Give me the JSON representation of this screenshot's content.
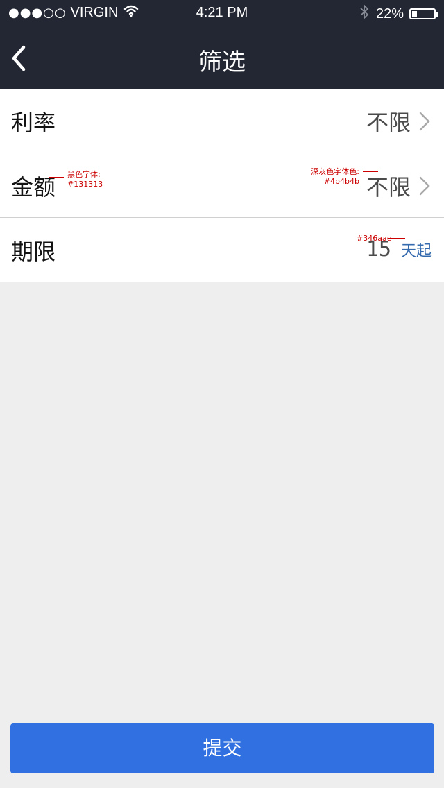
{
  "status_bar": {
    "signal": "●●●○○",
    "carrier": "VIRGIN",
    "time": "4:21 PM",
    "battery": "22%",
    "battery_level": 0.22
  },
  "nav": {
    "title": "筛选",
    "back_icon": "chevron-left-icon"
  },
  "filters": [
    {
      "label": "利率",
      "value": "不限"
    },
    {
      "label": "金额",
      "value": "不限"
    },
    {
      "label": "期限",
      "number": "15",
      "unit": "天起"
    }
  ],
  "annotations": {
    "black": {
      "title": "黑色字体:",
      "color": "#131313"
    },
    "gray": {
      "title": "深灰色字体色:",
      "color": "#4b4b4b"
    },
    "blue": {
      "color": "#346aae"
    }
  },
  "submit_label": "提交",
  "colors": {
    "header_bg": "#232733",
    "accent": "#3070e0",
    "unit_blue": "#346aae",
    "label_black": "#131313",
    "value_gray": "#4b4b4b",
    "page_bg": "#eeeeee"
  }
}
